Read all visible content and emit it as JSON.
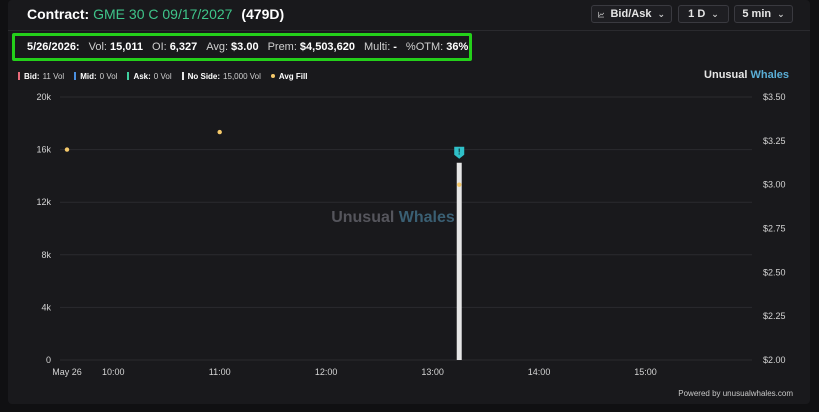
{
  "header": {
    "title_prefix": "Contract:",
    "symbol": "GME 30 C 09/17/2027",
    "dte": "(479D)",
    "controls": {
      "side_label": "Bid/Ask",
      "range_label": "1 D",
      "interval_label": "5 min"
    }
  },
  "stats": {
    "date": "5/26/2026:",
    "vol_label": "Vol:",
    "vol": "15,011",
    "oi_label": "OI:",
    "oi": "6,327",
    "avg_label": "Avg:",
    "avg": "$3.00",
    "prem_label": "Prem:",
    "prem": "$4,503,620",
    "multi_label": "Multi:",
    "multi": "-",
    "otm_label": "%OTM:",
    "otm": "36%"
  },
  "legend": [
    {
      "name": "Bid:",
      "value": "11 Vol",
      "color": "#e86a7a",
      "kind": "bar"
    },
    {
      "name": "Mid:",
      "value": "0 Vol",
      "color": "#4a8fe0",
      "kind": "bar"
    },
    {
      "name": "Ask:",
      "value": "0 Vol",
      "color": "#3fd0a0",
      "kind": "bar"
    },
    {
      "name": "No Side:",
      "value": "15,000 Vol",
      "color": "#e6e6e6",
      "kind": "bar"
    },
    {
      "name": "Avg Fill",
      "value": "",
      "color": "#f5c96a",
      "kind": "dot"
    }
  ],
  "brand": {
    "part1": "Unusual ",
    "part2": "Whales"
  },
  "watermark": {
    "part1": "Unusual ",
    "part2": "Whales"
  },
  "footer": {
    "powered": "Powered by unusualwhales.com"
  },
  "colors": {
    "no_side": "#e6e6e6",
    "avg_fill": "#f5c96a",
    "marker": "#2fc0c8",
    "grid": "#2a2a2e"
  },
  "chart_data": {
    "type": "bar",
    "x_ticks": [
      {
        "t": 0,
        "label": "May 26"
      },
      {
        "t": 30,
        "label": "10:00"
      },
      {
        "t": 90,
        "label": "11:00"
      },
      {
        "t": 150,
        "label": "12:00"
      },
      {
        "t": 210,
        "label": "13:00"
      },
      {
        "t": 270,
        "label": "14:00"
      },
      {
        "t": 330,
        "label": "15:00"
      }
    ],
    "xlim": [
      0,
      390
    ],
    "y_left": {
      "ylim": [
        0,
        20000
      ],
      "ticks": [
        0,
        4000,
        8000,
        12000,
        16000,
        20000
      ],
      "tick_labels": [
        "0",
        "4k",
        "8k",
        "12k",
        "16k",
        "20k"
      ]
    },
    "y_right": {
      "ylim": [
        2.0,
        3.5
      ],
      "ticks": [
        2.0,
        2.25,
        2.5,
        2.75,
        3.0,
        3.25,
        3.5
      ],
      "tick_labels": [
        "$2.00",
        "$2.25",
        "$2.50",
        "$2.75",
        "$3.00",
        "$3.25",
        "$3.50"
      ]
    },
    "volume_bars": [
      {
        "t": 225,
        "value": 15000,
        "side": "No Side"
      }
    ],
    "avg_fill_points": [
      {
        "t": 0,
        "price": 3.2
      },
      {
        "t": 90,
        "price": 3.3
      },
      {
        "t": 225,
        "price": 3.0
      }
    ],
    "marker": {
      "t": 225,
      "glyph": "!"
    },
    "grid": true,
    "legend_position": "top-left"
  }
}
